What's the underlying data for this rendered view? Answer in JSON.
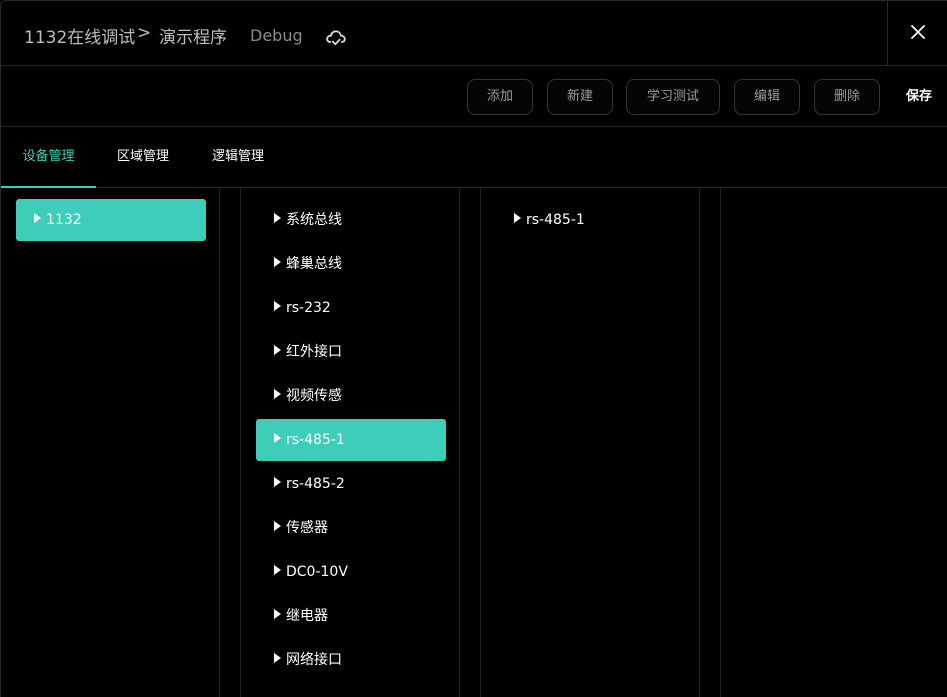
{
  "titlebar": {
    "breadcrumb_1": "1132在线调试",
    "separator": ">",
    "breadcrumb_2": "演示程序",
    "mode": "Debug",
    "cloud_icon": "cloud-check-icon",
    "close_icon": "close-icon"
  },
  "toolbar": {
    "add_label": "添加",
    "new_label": "新建",
    "learn_label": "学习测试",
    "edit_label": "编辑",
    "delete_label": "删除",
    "save_label": "保存"
  },
  "tabs": [
    {
      "label": "设备管理",
      "active": true
    },
    {
      "label": "区域管理",
      "active": false
    },
    {
      "label": "逻辑管理",
      "active": false
    }
  ],
  "columns": {
    "devices": [
      {
        "label": "1132",
        "selected": true
      }
    ],
    "interfaces": [
      {
        "label": "系统总线",
        "selected": false
      },
      {
        "label": "蜂巢总线",
        "selected": false
      },
      {
        "label": "rs-232",
        "selected": false
      },
      {
        "label": "红外接口",
        "selected": false
      },
      {
        "label": "视频传感",
        "selected": false
      },
      {
        "label": "rs-485-1",
        "selected": true
      },
      {
        "label": "rs-485-2",
        "selected": false
      },
      {
        "label": "传感器",
        "selected": false
      },
      {
        "label": "DC0-10V",
        "selected": false
      },
      {
        "label": "继电器",
        "selected": false
      },
      {
        "label": "网络接口",
        "selected": false
      }
    ],
    "channels": [
      {
        "label": "rs-485-1",
        "selected": false
      }
    ]
  },
  "colors": {
    "accent": "#3ecdb9",
    "background": "#000000",
    "border": "#2a2a2a"
  }
}
